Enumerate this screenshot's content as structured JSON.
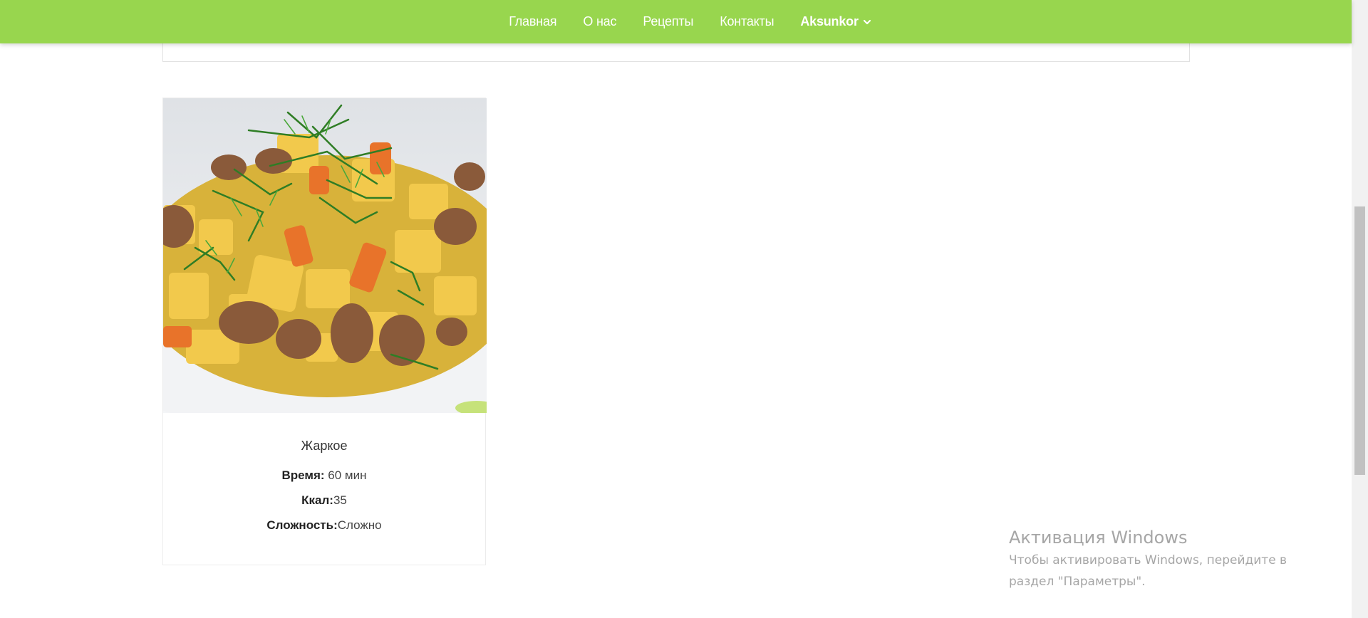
{
  "nav": {
    "items": [
      {
        "label": "Главная"
      },
      {
        "label": "О нас"
      },
      {
        "label": "Рецепты"
      },
      {
        "label": "Контакты"
      }
    ],
    "user": "Aksunkor",
    "user_icon": "chevron-down-icon"
  },
  "recipe": {
    "image_alt": "Жаркое",
    "title": "Жаркое",
    "time_label": "Время:",
    "time_value": "60 мин",
    "kcal_label": "Ккал:",
    "kcal_value": "35",
    "difficulty_label": "Сложность:",
    "difficulty_value": "Сложно"
  },
  "activation": {
    "title": "Активация Windows",
    "line1": "Чтобы активировать Windows, перейдите в",
    "line2": "раздел \"Параметры\"."
  },
  "colors": {
    "navbar": "#98d64e",
    "nav_text": "#ffffff",
    "watermark": "#a6a6a6"
  }
}
